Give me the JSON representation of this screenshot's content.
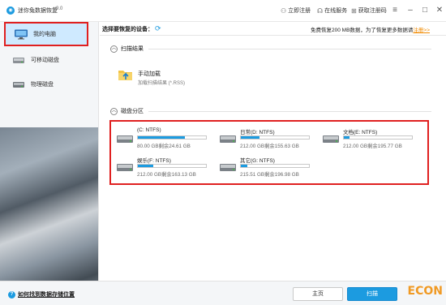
{
  "window": {
    "title": "迷你兔数据恢复",
    "version": "v9.0",
    "links": [
      {
        "label": "立即注册",
        "icon": "user-icon"
      },
      {
        "label": "在线服务",
        "icon": "headset-icon"
      },
      {
        "label": "获取注册码",
        "icon": "cart-icon"
      }
    ]
  },
  "sidebar": {
    "items": [
      {
        "label": "我的电脑",
        "icon": "monitor-icon"
      },
      {
        "label": "可移动磁盘",
        "icon": "usb-drive-icon"
      },
      {
        "label": "物理磁盘",
        "icon": "hard-disk-icon"
      }
    ]
  },
  "header": {
    "prompt": "选择要恢复的设备：",
    "free_notice": "免费恢复200 MB数据，为了恢复更多数据请",
    "register_link": "注册",
    "register_suffix": ">>"
  },
  "scan_results": {
    "title": "扫描结果",
    "manual_title": "手动加载",
    "manual_sub": "加载扫描结果 (*.RSS)"
  },
  "partitions": {
    "title": "磁盘分区",
    "items": [
      {
        "name": "(C: NTFS)",
        "size": "80.00 GB剩余24.61 GB",
        "used_fraction": 0.69
      },
      {
        "name": "日常(D: NTFS)",
        "size": "212.00 GB剩余155.63 GB",
        "used_fraction": 0.27
      },
      {
        "name": "文档(E: NTFS)",
        "size": "212.00 GB剩余195.77 GB",
        "used_fraction": 0.08
      },
      {
        "name": "娱乐(F: NTFS)",
        "size": "212.00 GB剩余163.13 GB",
        "used_fraction": 0.23
      },
      {
        "name": "其它(G: NTFS)",
        "size": "215.51 GB剩余196.98 GB",
        "used_fraction": 0.09
      }
    ]
  },
  "footer": {
    "help": "如何找到数据存储位置",
    "home_button": "主页",
    "scan_button": "扫描",
    "watermark": "ECON"
  },
  "colors": {
    "accent": "#1c9be0",
    "highlight_border": "#e02020",
    "register": "#f08a00"
  }
}
